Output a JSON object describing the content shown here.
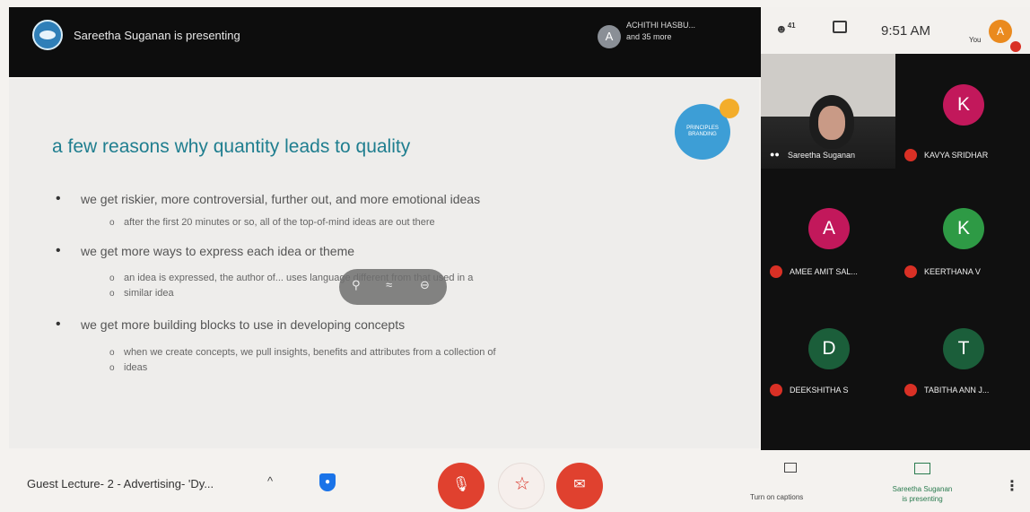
{
  "topbar": {
    "presenter_text": "Sareetha Suganan is presenting",
    "participants_initial": "A",
    "participants_line1": "ACHITHI HASBU...",
    "participants_line2": "and 35 more"
  },
  "status": {
    "people_count": "41",
    "time": "9:51 AM",
    "you_label": "You",
    "self_initial": "A"
  },
  "slide": {
    "logo_text": "PRINCIPLES BRANDING",
    "title": "a few reasons why quantity leads to quality",
    "bullets": [
      {
        "text": "we get riskier, more controversial, further out, and more emotional ideas",
        "subs": [
          "after the first 20 minutes or so, all of the top-of-mind ideas are out there"
        ]
      },
      {
        "text": "we get more ways to express each idea or theme",
        "subs": [
          "an idea is expressed, the author of... uses language different from that used in a",
          "similar idea"
        ]
      },
      {
        "text": "we get more building blocks to use in developing concepts",
        "subs": [
          "when we create concepts, we pull insights, benefits and attributes from a collection of",
          "ideas"
        ]
      }
    ],
    "overlay_icons": [
      "pin-icon",
      "mute-tile-icon",
      "remove-icon"
    ]
  },
  "tiles": {
    "self_name": "Sareetha Suganan",
    "participants": [
      {
        "initial": "K",
        "name": "KAVYA SRIDHAR",
        "color": "#c2185b"
      },
      {
        "initial": "A",
        "name": "AMEE AMIT SAL...",
        "color": "#c2185b"
      },
      {
        "initial": "K",
        "name": "KEERTHANA V",
        "color": "#2e9a45"
      },
      {
        "initial": "D",
        "name": "DEEKSHITHA S",
        "color": "#1b5e3a"
      },
      {
        "initial": "T",
        "name": "TABITHA ANN J...",
        "color": "#1b5e3a"
      }
    ]
  },
  "bottombar": {
    "meeting_title": "Guest Lecture- 2 - Advertising- 'Dy...",
    "shield_glyph": "●",
    "mic_glyph": "🎙",
    "end_glyph": "☆",
    "cam_glyph": "✉",
    "captions_label": "Turn on captions",
    "present_line1": "Sareetha Suganan",
    "present_line2": "is presenting"
  },
  "colors": {
    "accent_red": "#e0412f",
    "slide_title": "#1f7e8f",
    "presenting_green": "#2a7b4f"
  }
}
